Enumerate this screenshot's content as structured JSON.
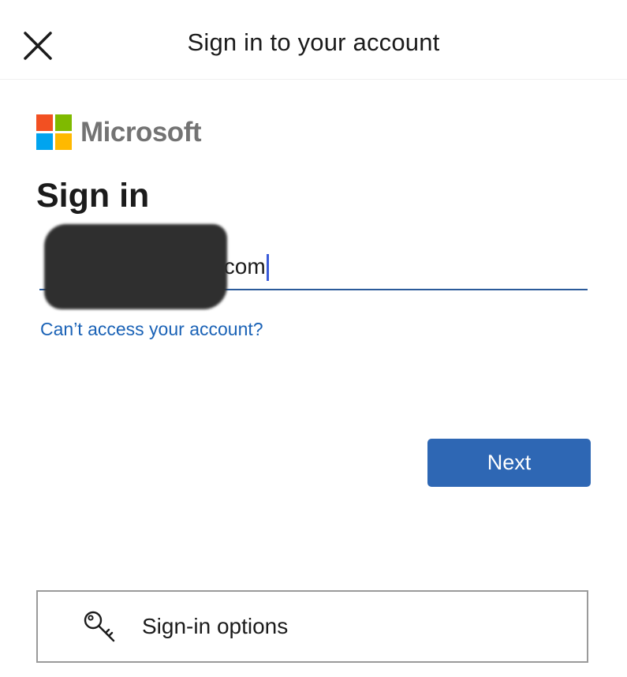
{
  "header": {
    "title": "Sign in to your account",
    "close_icon": "close-icon"
  },
  "brand": {
    "name": "Microsoft",
    "logo_colors": [
      "#f25022",
      "#7fba00",
      "#00a4ef",
      "#ffb900"
    ]
  },
  "form": {
    "heading": "Sign in",
    "email_value_visible": ".com",
    "email_redacted": true,
    "cant_access_link": "Can’t access your account?",
    "next_label": "Next"
  },
  "options": {
    "label": "Sign-in options",
    "icon": "key-icon"
  },
  "colors": {
    "accent": "#2e67b4",
    "link": "#1a62b6"
  }
}
